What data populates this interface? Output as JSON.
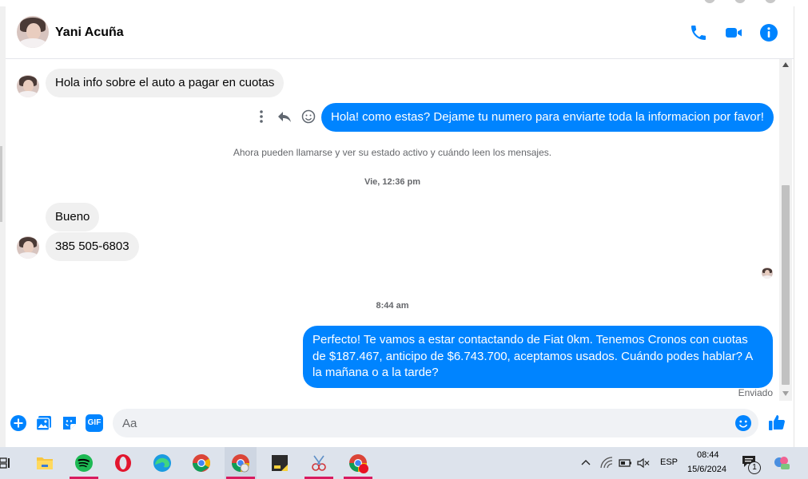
{
  "contact": {
    "name": "Yani Acuña"
  },
  "header_actions": [
    {
      "icon": "phone-icon"
    },
    {
      "icon": "video-camera-icon"
    },
    {
      "icon": "info-icon"
    }
  ],
  "messages": {
    "m1": "Hola info sobre el auto a pagar en cuotas",
    "m2": "Hola! como estas? Dejame tu numero para enviarte toda la informacion por favor!",
    "notice": "Ahora pueden llamarse y ver su estado activo y cuándo leen los mensajes.",
    "time1": "Vie, 12:36 pm",
    "m3": "Bueno",
    "m4": "385 505-6803",
    "time2": "8:44 am",
    "m5": "Perfecto! Te vamos a estar contactando de Fiat 0km. Tenemos Cronos con cuotas de $187.467, anticipo de $6.743.700, aceptamos usados. Cuándo podes hablar? A la mañana o a la tarde?",
    "status": "Enviado"
  },
  "composer": {
    "placeholder": "Aa",
    "actions": [
      "plus-icon",
      "image-icon",
      "sticker-icon",
      "gif-icon"
    ],
    "gif_label": "GIF"
  },
  "taskbar": {
    "apps": [
      "task-view-icon",
      "file-explorer-icon",
      "spotify-icon",
      "opera-icon",
      "edge-icon",
      "chrome-icon",
      "chrome-profile-icon",
      "sticky-notes-icon",
      "snipping-tool-icon",
      "chrome-notification-icon"
    ],
    "language": "ESP",
    "time": "08:44",
    "date": "15/6/2024",
    "notification_count": "1"
  },
  "colors": {
    "accent": "#0084ff",
    "incoming_bubble": "#f0f0f0",
    "taskbar": "#dde3ec"
  }
}
